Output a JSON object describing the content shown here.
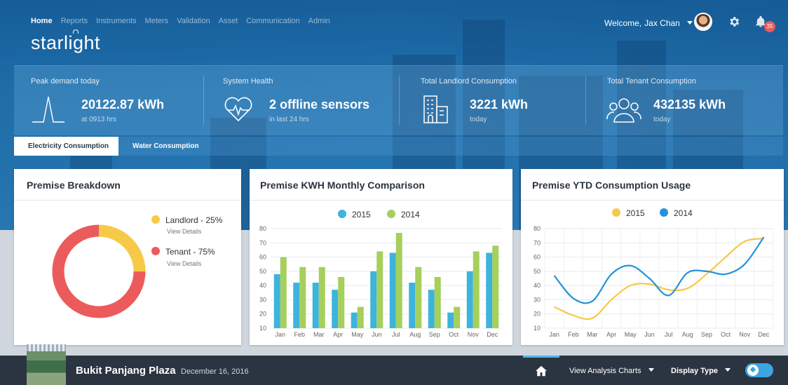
{
  "nav": {
    "items": [
      "Home",
      "Reports",
      "Instruments",
      "Meters",
      "Validation",
      "Asset",
      "Communication",
      "Admin"
    ],
    "active": "Home"
  },
  "brand": {
    "logo": "starlight"
  },
  "user": {
    "welcome": "Welcome,",
    "name": "Jax Chan",
    "notifications": "35"
  },
  "stats": {
    "peak": {
      "label": "Peak demand today",
      "value": "20122.87 kWh",
      "sub": "at 0913 hrs"
    },
    "health": {
      "label": "System Health",
      "value": "2 offline sensors",
      "sub": "in last 24 hrs"
    },
    "landlord": {
      "label": "Total Landlord Consumption",
      "value": "3221 kWh",
      "sub": "today"
    },
    "tenant": {
      "label": "Total Tenant Consumption",
      "value": "432135 kWh",
      "sub": "today"
    }
  },
  "tabs": {
    "electricity": "Electricity Consumption",
    "water": "Water Consumption"
  },
  "cards": {
    "breakdown": {
      "title": "Premise Breakdown",
      "landlord": "Landlord - 25%",
      "tenant": "Tenant - 75%",
      "view_details": "View Details"
    },
    "monthly": {
      "title": "Premise KWH Monthly Comparison"
    },
    "ytd": {
      "title": "Premise YTD Consumption Usage"
    }
  },
  "colors": {
    "blue": "#3db4dc",
    "green": "#a6cf5c",
    "yellow": "#f7c948",
    "lineBlue": "#2493d8",
    "red": "#ec5b5b"
  },
  "chart_data": [
    {
      "type": "pie",
      "labels": [
        "Landlord",
        "Tenant"
      ],
      "values": [
        25,
        75
      ]
    },
    {
      "type": "bar",
      "categories": [
        "Jan",
        "Feb",
        "Mar",
        "Apr",
        "May",
        "Jun",
        "Jul",
        "Aug",
        "Sep",
        "Oct",
        "Nov",
        "Dec"
      ],
      "series": [
        {
          "name": "2015",
          "values": [
            48,
            42,
            42,
            37,
            21,
            50,
            63,
            42,
            37,
            21,
            50,
            63
          ]
        },
        {
          "name": "2014",
          "values": [
            60,
            53,
            53,
            46,
            25,
            64,
            77,
            53,
            46,
            25,
            64,
            68
          ]
        }
      ],
      "ylim": [
        10,
        80
      ],
      "yticks": [
        10,
        20,
        30,
        40,
        50,
        60,
        70,
        80
      ]
    },
    {
      "type": "line",
      "x": [
        "Jan",
        "Feb",
        "Mar",
        "Apr",
        "May",
        "Jun",
        "Jul",
        "Aug",
        "Sep",
        "Oct",
        "Nov",
        "Dec"
      ],
      "series": [
        {
          "name": "2015",
          "values": [
            25,
            19,
            17,
            30,
            40,
            41,
            37,
            38,
            48,
            60,
            71,
            73
          ]
        },
        {
          "name": "2014",
          "values": [
            47,
            31,
            29,
            48,
            54,
            45,
            33,
            49,
            50,
            48,
            55,
            74
          ]
        }
      ],
      "ylim": [
        10,
        80
      ],
      "yticks": [
        10,
        20,
        30,
        40,
        50,
        60,
        70,
        80
      ]
    }
  ],
  "footer": {
    "place": "Bukit Panjang Plaza",
    "date": "December 16, 2016",
    "analysis": "View Analysis Charts",
    "display": "Display Type"
  }
}
